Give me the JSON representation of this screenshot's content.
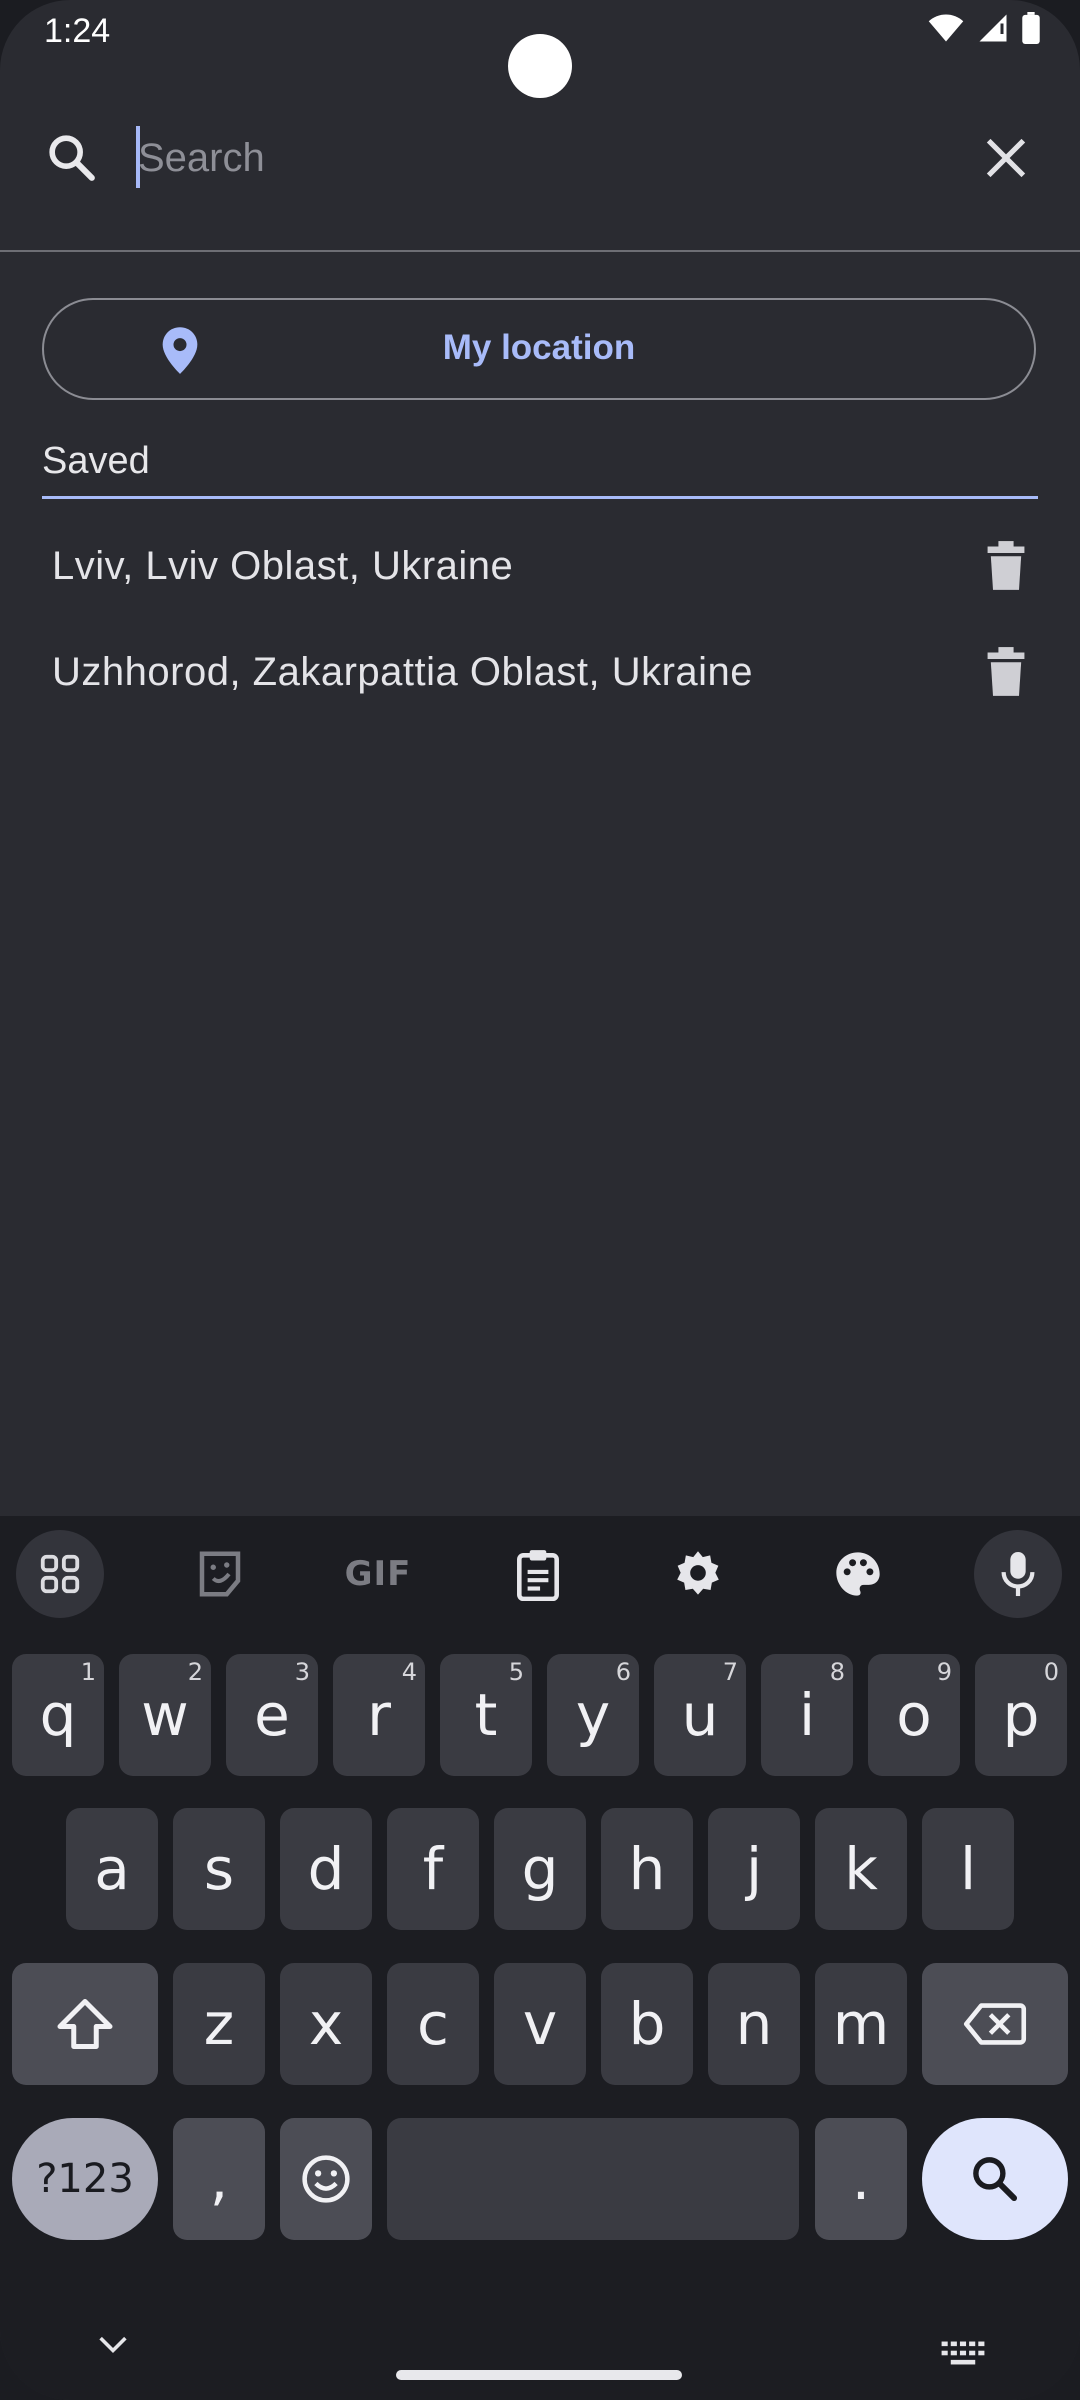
{
  "status": {
    "time": "1:24",
    "icons": [
      "wifi-icon",
      "cell-signal-icon",
      "battery-icon"
    ]
  },
  "search": {
    "placeholder": "Search",
    "value": ""
  },
  "location_button": {
    "label": "My location",
    "icon": "location-pin-icon"
  },
  "saved": {
    "label": "Saved",
    "items": [
      {
        "name": "Lviv, Lviv Oblast, Ukraine"
      },
      {
        "name": "Uzhhorod, Zakarpattia Oblast, Ukraine"
      }
    ]
  },
  "keyboard": {
    "toolbar": [
      "apps-grid-icon",
      "sticker-icon",
      "GIF",
      "clipboard-icon",
      "settings-icon",
      "palette-icon",
      "microphone-icon"
    ],
    "row1": [
      {
        "k": "q",
        "s": "1"
      },
      {
        "k": "w",
        "s": "2"
      },
      {
        "k": "e",
        "s": "3"
      },
      {
        "k": "r",
        "s": "4"
      },
      {
        "k": "t",
        "s": "5"
      },
      {
        "k": "y",
        "s": "6"
      },
      {
        "k": "u",
        "s": "7"
      },
      {
        "k": "i",
        "s": "8"
      },
      {
        "k": "o",
        "s": "9"
      },
      {
        "k": "p",
        "s": "0"
      }
    ],
    "row2": [
      "a",
      "s",
      "d",
      "f",
      "g",
      "h",
      "j",
      "k",
      "l"
    ],
    "row3": [
      "z",
      "x",
      "c",
      "v",
      "b",
      "n",
      "m"
    ],
    "sym_label": "?123",
    "comma": ",",
    "period": "."
  },
  "colors": {
    "background": "#2a2b31",
    "accent": "#a8bbf9",
    "keyboard_bg": "#1c1d22",
    "key_bg": "#3a3b42"
  }
}
